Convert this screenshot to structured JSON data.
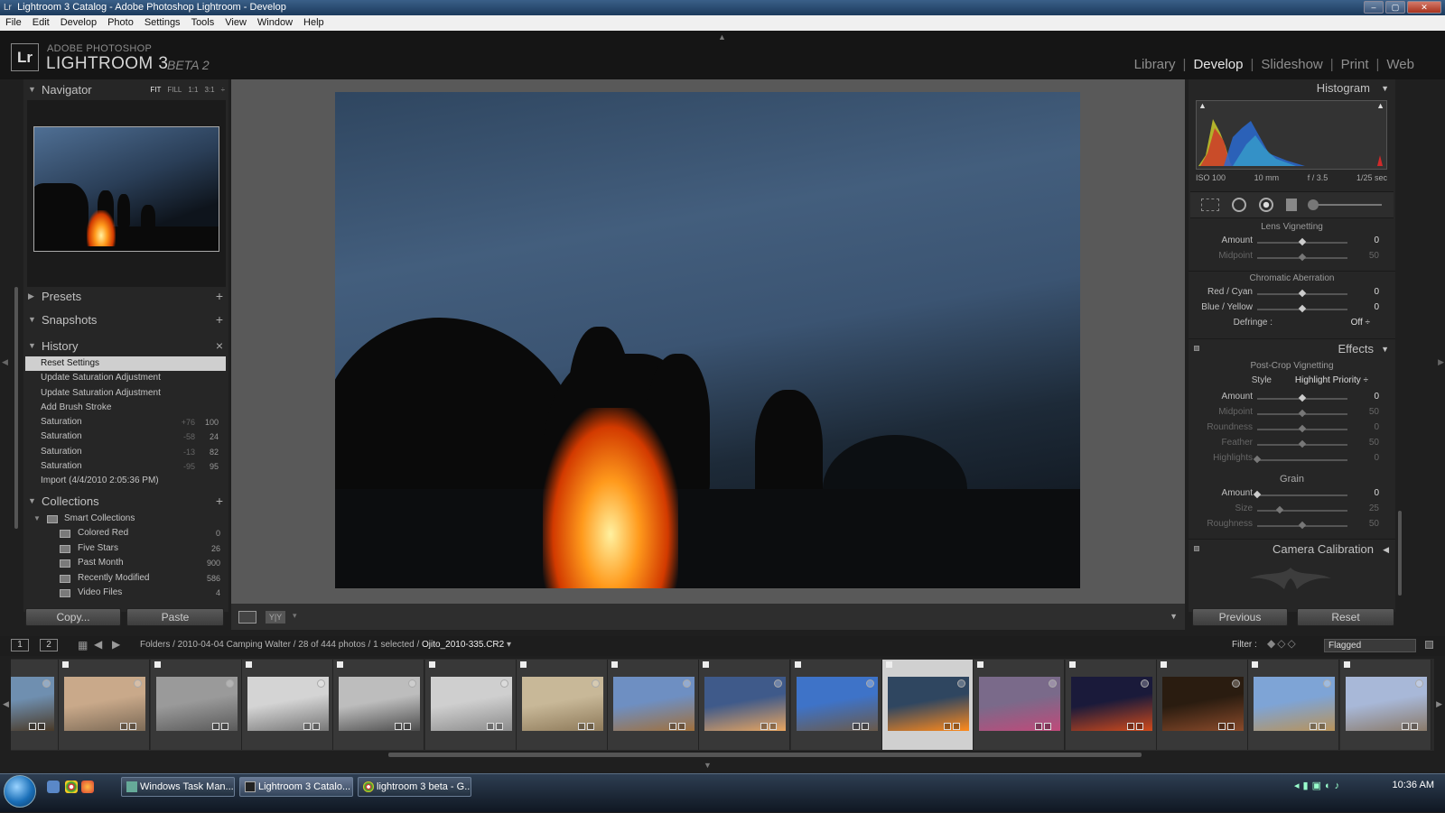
{
  "window": {
    "title": "Lightroom 3 Catalog - Adobe Photoshop Lightroom - Develop",
    "controls": [
      "–",
      "▢",
      "✕"
    ]
  },
  "menu": [
    "File",
    "Edit",
    "Develop",
    "Photo",
    "Settings",
    "Tools",
    "View",
    "Window",
    "Help"
  ],
  "branding": {
    "logo": "Lr",
    "small": "ADOBE PHOTOSHOP",
    "big": "LIGHTROOM 3",
    "beta": "BETA 2"
  },
  "modules": [
    {
      "label": "Library",
      "active": false
    },
    {
      "label": "Develop",
      "active": true
    },
    {
      "label": "Slideshow",
      "active": false
    },
    {
      "label": "Print",
      "active": false
    },
    {
      "label": "Web",
      "active": false
    }
  ],
  "module_separator": "|",
  "navigator": {
    "title": "Navigator",
    "zoom": [
      "FIT",
      "FILL",
      "1:1",
      "3:1"
    ],
    "zoom_active": "FIT"
  },
  "presets": {
    "title": "Presets",
    "action": "+"
  },
  "snapshots": {
    "title": "Snapshots",
    "action": "+"
  },
  "history": {
    "title": "History",
    "action": "×",
    "items": [
      {
        "label": "Reset Settings",
        "a": "",
        "b": ""
      },
      {
        "label": "Update Saturation Adjustment",
        "a": "",
        "b": ""
      },
      {
        "label": "Update Saturation Adjustment",
        "a": "",
        "b": ""
      },
      {
        "label": "Add Brush Stroke",
        "a": "",
        "b": ""
      },
      {
        "label": "Saturation",
        "a": "+76",
        "b": "100"
      },
      {
        "label": "Saturation",
        "a": "-58",
        "b": "24"
      },
      {
        "label": "Saturation",
        "a": "-13",
        "b": "82"
      },
      {
        "label": "Saturation",
        "a": "-95",
        "b": "95"
      },
      {
        "label": "Import (4/4/2010 2:05:36 PM)",
        "a": "",
        "b": ""
      }
    ]
  },
  "collections": {
    "title": "Collections",
    "action": "+",
    "group": "Smart Collections",
    "items": [
      {
        "label": "Colored Red",
        "count": "0"
      },
      {
        "label": "Five Stars",
        "count": "26"
      },
      {
        "label": "Past Month",
        "count": "900"
      },
      {
        "label": "Recently Modified",
        "count": "586"
      },
      {
        "label": "Video Files",
        "count": "4"
      }
    ]
  },
  "left_buttons": {
    "copy": "Copy...",
    "paste": "Paste"
  },
  "right_buttons": {
    "previous": "Previous",
    "reset": "Reset"
  },
  "histogram": {
    "title": "Histogram",
    "iso": "ISO 100",
    "focal": "10 mm",
    "aperture": "f / 3.5",
    "shutter": "1/25 sec"
  },
  "lens_vignetting": {
    "title": "Lens Vignetting",
    "rows": [
      {
        "label": "Amount",
        "value": "0",
        "pos": 0.5,
        "dim": false
      },
      {
        "label": "Midpoint",
        "value": "50",
        "pos": 0.5,
        "dim": true
      }
    ]
  },
  "chromatic_aberration": {
    "title": "Chromatic Aberration",
    "rows": [
      {
        "label": "Red / Cyan",
        "value": "0",
        "pos": 0.5,
        "dim": false
      },
      {
        "label": "Blue / Yellow",
        "value": "0",
        "pos": 0.5,
        "dim": false
      }
    ],
    "defringe_label": "Defringe :",
    "defringe_value": "Off ÷"
  },
  "effects": {
    "title": "Effects",
    "post_crop_title": "Post-Crop Vignetting",
    "style_label": "Style",
    "style_value": "Highlight Priority ÷",
    "post_crop_rows": [
      {
        "label": "Amount",
        "value": "0",
        "pos": 0.5,
        "dim": false
      },
      {
        "label": "Midpoint",
        "value": "50",
        "pos": 0.5,
        "dim": true
      },
      {
        "label": "Roundness",
        "value": "0",
        "pos": 0.5,
        "dim": true
      },
      {
        "label": "Feather",
        "value": "50",
        "pos": 0.5,
        "dim": true
      },
      {
        "label": "Highlights",
        "value": "0",
        "pos": 0.0,
        "dim": true
      }
    ],
    "grain_title": "Grain",
    "grain_rows": [
      {
        "label": "Amount",
        "value": "0",
        "pos": 0.0,
        "dim": false
      },
      {
        "label": "Size",
        "value": "25",
        "pos": 0.25,
        "dim": true
      },
      {
        "label": "Roughness",
        "value": "50",
        "pos": 0.5,
        "dim": true
      }
    ]
  },
  "camera_calibration": {
    "title": "Camera Calibration"
  },
  "filmbar": {
    "screen1": "1",
    "screen2": "2",
    "path_prefix": "Folders / 2010-04-04 Camping Walter / 28 of 444 photos / 1 selected /",
    "filename": "Ojito_2010-335.CR2",
    "filename_arrow": "▾",
    "filter_label": "Filter :",
    "filter_value": "Flagged"
  },
  "filmstrip": {
    "selected_index": 9,
    "thumbs": [
      {
        "c1": "#6f8fb0",
        "c2": "#4a3a28"
      },
      {
        "c1": "#c9a98a",
        "c2": "#7c6a56"
      },
      {
        "c1": "#9a9a9a",
        "c2": "#5a5a5a"
      },
      {
        "c1": "#d4d4d4",
        "c2": "#777777"
      },
      {
        "c1": "#bdbdbd",
        "c2": "#4d4d4d"
      },
      {
        "c1": "#cfcfcf",
        "c2": "#8c8c8c"
      },
      {
        "c1": "#c8b898",
        "c2": "#8e7a5a"
      },
      {
        "c1": "#6e8fc2",
        "c2": "#a0703c"
      },
      {
        "c1": "#3f5a8a",
        "c2": "#e8a560"
      },
      {
        "c1": "#3e73c8",
        "c2": "#6a5a4a"
      },
      {
        "c1": "#2f4660",
        "c2": "#ff8a1c"
      },
      {
        "c1": "#7a6a8a",
        "c2": "#c04a7a"
      },
      {
        "c1": "#1a1a3a",
        "c2": "#d04a1c"
      },
      {
        "c1": "#2a1c10",
        "c2": "#8a4a2a"
      },
      {
        "c1": "#7ea4d6",
        "c2": "#b8935a"
      },
      {
        "c1": "#a8b8d8",
        "c2": "#8a7a6a"
      }
    ]
  },
  "taskbar": {
    "tasks": [
      "Windows Task Man...",
      "Lightroom 3 Catalo...",
      "lightroom 3 beta - G..."
    ],
    "clock": "10:36 AM"
  },
  "colors": {
    "accent": "#cfcfcf",
    "panel": "#262626",
    "canvas": "#595959"
  }
}
